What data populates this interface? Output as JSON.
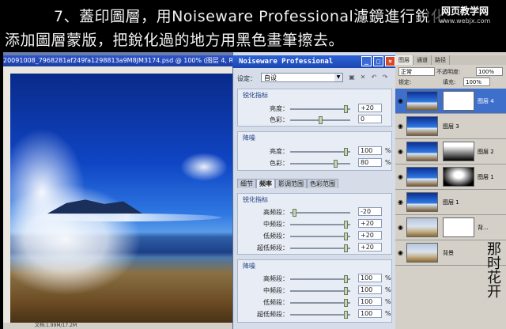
{
  "caption": {
    "line1": "7、蓋印圖層，用Noiseware Professional濾鏡進行銳化",
    "line2": "添加圖層蒙版，把銳化過的地方用黑色畫筆擦去。"
  },
  "watermark": {
    "line1": "网页教学网",
    "line2": "www.webjx.com"
  },
  "document": {
    "title": "20091008_7968281af249fa1298813a9M8JM3174.psd @ 100% (图层 4, RGB/8)",
    "status": "文档:1.99M/17.2M"
  },
  "noiseware": {
    "title": "Noiseware Professional",
    "preset_label": "设定：",
    "preset_value": "自设",
    "sharpen_group": {
      "title": "锐化指标",
      "rows": [
        {
          "label": "亮度：",
          "value": "+20",
          "level": 0.96
        },
        {
          "label": "色彩：",
          "value": "0",
          "level": 0.5
        }
      ]
    },
    "noise_group": {
      "title": "降噪",
      "rows": [
        {
          "label": "亮度：",
          "value": "100",
          "unit": "%",
          "level": 0.96
        },
        {
          "label": "色彩：",
          "value": "80",
          "unit": "%",
          "level": 0.78
        }
      ]
    },
    "tabs": [
      "细节",
      "频率",
      "影调范围",
      "色彩范围"
    ],
    "freq_sharpen_group": {
      "title": "锐化指标",
      "rows": [
        {
          "label": "高频段：",
          "value": "-20",
          "level": 0.04
        },
        {
          "label": "中频段：",
          "value": "+20",
          "level": 0.96
        },
        {
          "label": "低频段：",
          "value": "+20",
          "level": 0.96
        },
        {
          "label": "超低频段：",
          "value": "+20",
          "level": 0.96
        }
      ]
    },
    "freq_noise_group": {
      "title": "降噪",
      "rows": [
        {
          "label": "高频段：",
          "value": "100",
          "unit": "%",
          "level": 0.96
        },
        {
          "label": "中频段：",
          "value": "100",
          "unit": "%",
          "level": 0.96
        },
        {
          "label": "低频段：",
          "value": "100",
          "unit": "%",
          "level": 0.96
        },
        {
          "label": "超低频段：",
          "value": "100",
          "unit": "%",
          "level": 0.96
        }
      ]
    }
  },
  "layers_panel": {
    "tabs": [
      "图层",
      "通道",
      "路径"
    ],
    "blend_mode": "正常",
    "opacity_label": "不透明度:",
    "opacity_value": "100%",
    "lock_label": "锁定:",
    "fill_label": "填充:",
    "fill_value": "100%",
    "layers": [
      {
        "name": "图层 4",
        "selected": true
      },
      {
        "name": "图层 3",
        "selected": false
      },
      {
        "name": "图层 2",
        "selected": false
      },
      {
        "name": "图层 1",
        "selected": false
      },
      {
        "name": "图层 1",
        "selected": false
      },
      {
        "name": "背...",
        "selected": false
      },
      {
        "name": "背景",
        "selected": false
      }
    ]
  },
  "signature": "那时花开"
}
